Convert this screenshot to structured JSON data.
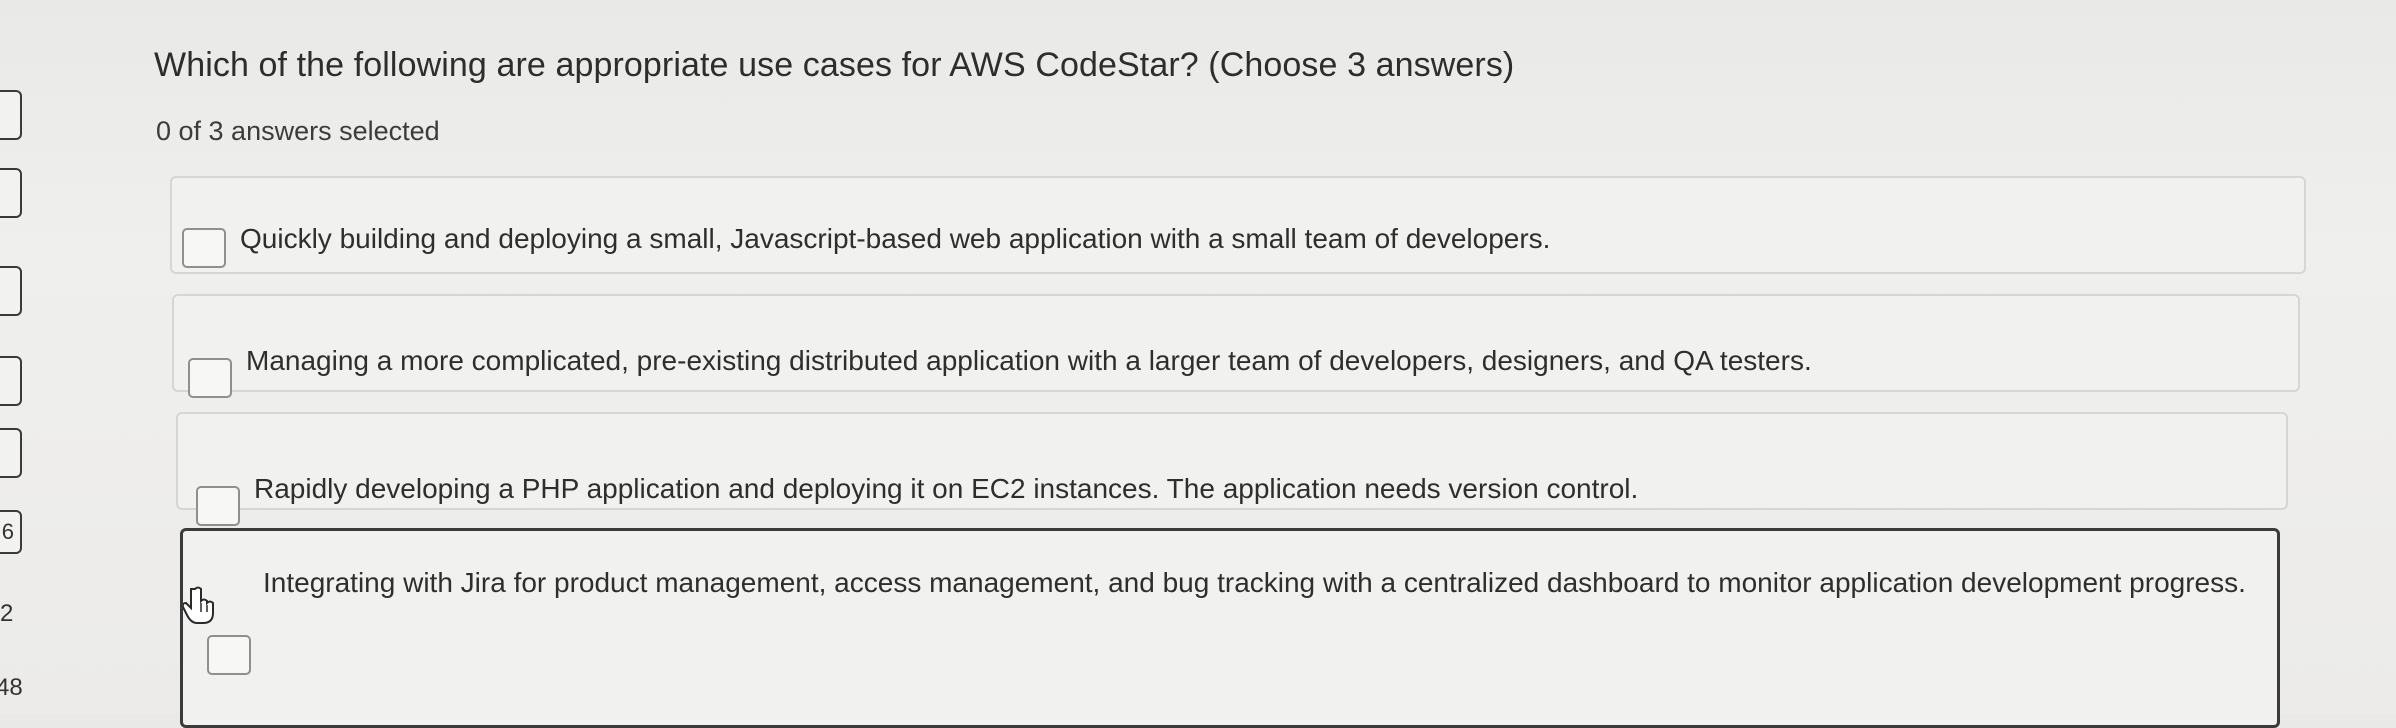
{
  "question": {
    "text": "Which of the following are appropriate use cases for AWS CodeStar? (Choose 3 answers)",
    "selected_status": "0 of 3 answers selected"
  },
  "options": [
    {
      "text": "Quickly building and deploying a small, Javascript-based web application with a small team of developers.",
      "checked": false
    },
    {
      "text": "Managing a more complicated, pre-existing distributed application with a larger team of developers, designers, and QA testers.",
      "checked": false
    },
    {
      "text": "Rapidly developing a PHP application and deploying it on EC2 instances. The application needs version control.",
      "checked": false
    },
    {
      "text": "Integrating with Jira for product management, access management, and bug tracking with a centralized dashboard to monitor application development progress.",
      "checked": false
    }
  ],
  "side_nav": {
    "visible_numbers": [
      "2",
      "48"
    ],
    "partial_label": "6"
  },
  "colors": {
    "background": "#ecebea",
    "option_border": "#d6d6d4",
    "hover_border": "#3b3b3b",
    "text": "#2d2d2d"
  },
  "icons": {
    "cursor": "hand-pointer-icon"
  }
}
